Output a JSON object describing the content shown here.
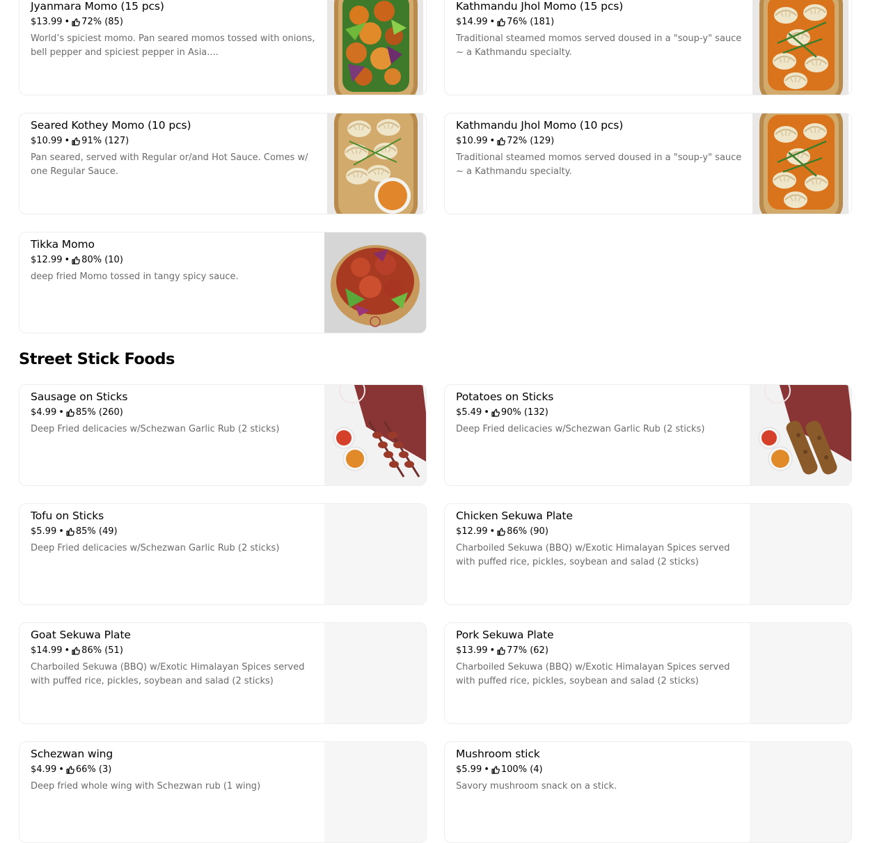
{
  "sections": {
    "street_stick_title": "Street Stick Foods"
  },
  "items": [
    {
      "name": "Jyanmara Momo (15 pcs)",
      "price": "$13.99",
      "rating": "72% (85)",
      "description": "World’s spiciest momo. Pan seared momos tossed with onions, bell pepper and spiciest pepper in Asia....",
      "image": "spicy-momo-bowl"
    },
    {
      "name": "Kathmandu Jhol Momo (15 pcs)",
      "price": "$14.99",
      "rating": "76% (181)",
      "description": "Traditional steamed momos served doused in a \"soup-y\" sauce ~ a Kathmandu specialty.",
      "image": "jhol-momo-bowl"
    },
    {
      "name": "Seared Kothey Momo (10 pcs)",
      "price": "$10.99",
      "rating": "91% (127)",
      "description": "Pan seared, served with Regular or/and Hot Sauce. Comes w/ one Regular Sauce.",
      "image": "kothey-momo-bowl"
    },
    {
      "name": "Kathmandu Jhol Momo (10 pcs)",
      "price": "$10.99",
      "rating": "72% (129)",
      "description": "Traditional steamed momos served doused in a \"soup-y\" sauce ~ a Kathmandu specialty.",
      "image": "jhol-momo-bowl"
    },
    {
      "name": "Tikka Momo",
      "price": "$12.99",
      "rating": "80% (10)",
      "description": "deep fried Momo tossed in tangy spicy sauce.",
      "image": "tikka-momo-bowl"
    },
    {
      "name": "Sausage on Sticks",
      "price": "$4.99",
      "rating": "85% (260)",
      "description": "Deep Fried delicacies w/Schezwan Garlic Rub (2 sticks)",
      "image": "sausage-sticks"
    },
    {
      "name": "Potatoes on Sticks",
      "price": "$5.49",
      "rating": "90% (132)",
      "description": "Deep Fried delicacies w/Schezwan Garlic Rub (2 sticks)",
      "image": "potato-sticks"
    },
    {
      "name": "Tofu on Sticks",
      "price": "$5.99",
      "rating": "85% (49)",
      "description": "Deep Fried delicacies w/Schezwan Garlic Rub (2 sticks)",
      "image": "none"
    },
    {
      "name": "Chicken Sekuwa Plate",
      "price": "$12.99",
      "rating": "86% (90)",
      "description": "Charboiled Sekuwa (BBQ) w/Exotic Himalayan Spices served with puffed rice, pickles, soybean and salad (2 sticks)",
      "image": "none"
    },
    {
      "name": "Goat Sekuwa Plate",
      "price": "$14.99",
      "rating": "86% (51)",
      "description": "Charboiled Sekuwa (BBQ) w/Exotic Himalayan Spices served with puffed rice, pickles, soybean and salad (2 sticks)",
      "image": "none"
    },
    {
      "name": "Pork Sekuwa Plate",
      "price": "$13.99",
      "rating": "77% (62)",
      "description": "Charboiled Sekuwa (BBQ) w/Exotic Himalayan Spices served with puffed rice, pickles, soybean and salad (2 sticks)",
      "image": "none"
    },
    {
      "name": "Schezwan wing",
      "price": "$4.99",
      "rating": "66% (3)",
      "description": "Deep fried whole wing with Schezwan rub (1 wing)",
      "image": "none"
    },
    {
      "name": "Mushroom stick",
      "price": "$5.99",
      "rating": "100% (4)",
      "description": "Savory mushroom snack on a stick.",
      "image": "none"
    }
  ],
  "colors": {
    "card_border": "#eeeeee",
    "description_text": "#6b6b6b",
    "placeholder_bg": "#f6f6f6"
  }
}
